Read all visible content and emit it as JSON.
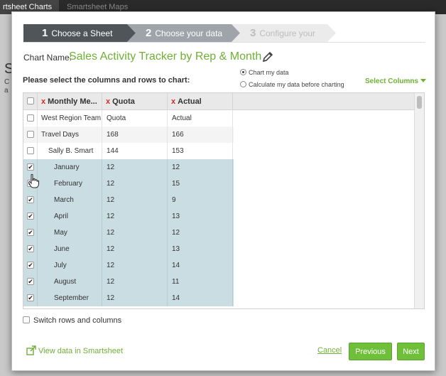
{
  "app": {
    "tabs": [
      {
        "label": "rtsheet Charts",
        "active": true
      },
      {
        "label": "Smartsheet Maps",
        "active": false
      }
    ],
    "bg_letter": "S",
    "bg_fragments": [
      "C",
      "a"
    ]
  },
  "wizard": {
    "steps": [
      {
        "number": "1",
        "label": "Choose a Sheet",
        "state": "done"
      },
      {
        "number": "2",
        "label": "Choose your data",
        "state": "current"
      },
      {
        "number": "3",
        "label": "Configure your chart",
        "state": "upcoming"
      }
    ]
  },
  "chart_name": {
    "label": "Chart Name:",
    "value": "Sales Activity Tracker by Rep & Month"
  },
  "selection": {
    "heading": "Please select the columns and rows to chart:",
    "options": [
      {
        "label": "Chart my data",
        "selected": true
      },
      {
        "label": "Calculate my data before charting",
        "selected": false
      }
    ],
    "select_columns_label": "Select Columns"
  },
  "grid": {
    "columns": [
      {
        "label": "Monthly Me...",
        "remove_mark": "x"
      },
      {
        "label": "Quota",
        "remove_mark": "x"
      },
      {
        "label": "Actual",
        "remove_mark": "x"
      }
    ],
    "rows": [
      {
        "name": "West Region Team",
        "quota": "Quota",
        "actual": "Actual",
        "checked": false,
        "indent": 0
      },
      {
        "name": "Travel Days",
        "quota": "168",
        "actual": "166",
        "checked": false,
        "indent": 0
      },
      {
        "name": "Sally B. Smart",
        "quota": "144",
        "actual": "153",
        "checked": false,
        "indent": 1
      },
      {
        "name": "January",
        "quota": "12",
        "actual": "12",
        "checked": true,
        "indent": 2
      },
      {
        "name": "February",
        "quota": "12",
        "actual": "15",
        "checked": true,
        "indent": 2
      },
      {
        "name": "March",
        "quota": "12",
        "actual": "9",
        "checked": true,
        "indent": 2
      },
      {
        "name": "April",
        "quota": "12",
        "actual": "13",
        "checked": true,
        "indent": 2
      },
      {
        "name": "May",
        "quota": "12",
        "actual": "12",
        "checked": true,
        "indent": 2
      },
      {
        "name": "June",
        "quota": "12",
        "actual": "13",
        "checked": true,
        "indent": 2
      },
      {
        "name": "July",
        "quota": "12",
        "actual": "14",
        "checked": true,
        "indent": 2
      },
      {
        "name": "August",
        "quota": "12",
        "actual": "11",
        "checked": true,
        "indent": 2
      },
      {
        "name": "September",
        "quota": "12",
        "actual": "14",
        "checked": true,
        "indent": 2
      }
    ]
  },
  "switch_rows": {
    "label": "Switch rows and columns",
    "checked": false
  },
  "footer": {
    "view_link": "View data in Smartsheet",
    "cancel": "Cancel",
    "previous": "Previous",
    "next": "Next"
  },
  "colors": {
    "accent_green": "#6fb035",
    "button_green": "#6fbf3a",
    "selected_row": "#c9dde3",
    "remove_red": "#d12b2b"
  }
}
